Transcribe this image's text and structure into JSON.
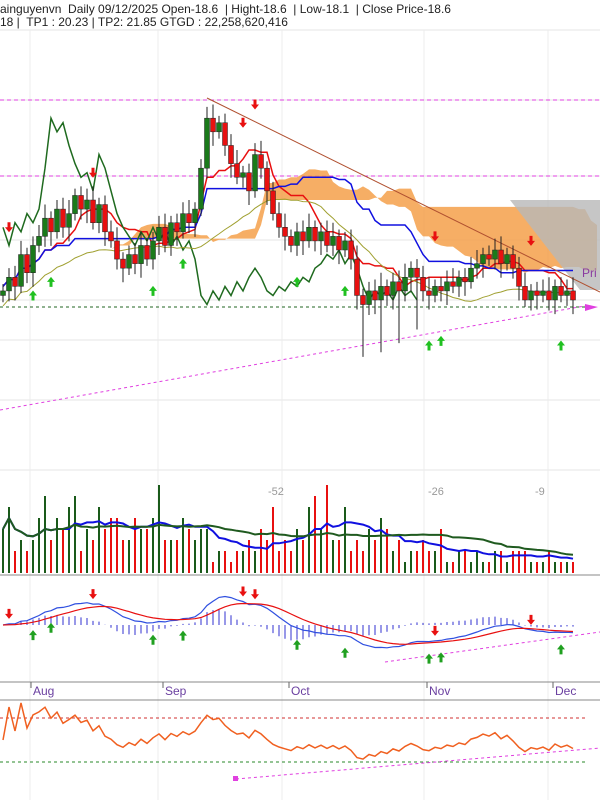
{
  "header": {
    "line1": "ainguyenvn  Daily 09/12/2025 Open-18.6  | Hight-18.6  | Low-18.1  | Close Price-18.6",
    "line2": "18 |  TP1 : 20.23 | TP2: 21.85 GTGD : 22,258,620,416"
  },
  "price_tag": "Pri",
  "volume_labels": [
    "-52",
    "-26",
    "-9"
  ],
  "colors": {
    "up": "#1a7a1a",
    "down": "#e81010",
    "ma_fast": "#e81010",
    "ma_slow": "#1010e0",
    "cloud": "#f5a04a",
    "trend": "#b05030",
    "support": "#e040e0"
  },
  "chart_data": {
    "type": "candlestick",
    "title": "Daily 09/12/2025",
    "months": [
      "Aug",
      "Sep",
      "Oct",
      "Nov",
      "Dec"
    ],
    "month_start_index": [
      4,
      26,
      47,
      70,
      91
    ],
    "close": [
      18.8,
      19.1,
      18.9,
      19.6,
      19.2,
      19.8,
      20.0,
      20.4,
      20.1,
      20.6,
      20.2,
      20.5,
      20.9,
      20.6,
      20.8,
      20.3,
      20.7,
      20.1,
      19.9,
      19.5,
      19.3,
      19.6,
      19.4,
      19.8,
      19.5,
      19.9,
      20.2,
      19.8,
      20.3,
      20.1,
      20.5,
      20.3,
      20.6,
      21.5,
      22.6,
      22.3,
      22.5,
      22.0,
      21.6,
      21.3,
      21.4,
      21.0,
      21.8,
      21.5,
      21.0,
      20.5,
      20.2,
      20.0,
      19.8,
      20.1,
      19.9,
      20.2,
      19.9,
      20.1,
      19.8,
      20.0,
      19.7,
      19.9,
      19.5,
      18.7,
      18.5,
      18.8,
      18.6,
      18.9,
      18.7,
      19.0,
      18.8,
      19.1,
      19.3,
      19.1,
      18.8,
      18.7,
      18.9,
      18.8,
      19.0,
      18.9,
      19.1,
      19.0,
      19.3,
      19.4,
      19.6,
      19.5,
      19.7,
      19.4,
      19.6,
      19.3,
      18.9,
      18.6,
      18.8,
      18.7,
      18.8,
      18.6,
      18.9,
      18.7,
      18.8,
      18.6
    ],
    "volume": [
      4,
      6,
      2,
      3,
      2,
      3,
      5,
      7,
      3,
      5,
      4,
      6,
      7,
      2,
      4,
      3,
      6,
      4,
      5,
      5,
      3,
      3,
      5,
      4,
      4,
      5,
      8,
      3,
      3,
      3,
      5,
      4,
      3,
      4,
      4,
      1,
      2,
      2,
      1,
      2,
      2,
      3,
      2,
      4,
      3,
      6,
      2,
      3,
      2,
      4,
      3,
      6,
      7,
      4,
      8,
      3,
      3,
      6,
      2,
      3,
      2,
      4,
      3,
      5,
      4,
      2,
      3,
      1,
      2,
      2,
      3,
      2,
      2,
      4,
      1,
      1,
      2,
      2,
      1,
      2,
      1,
      1,
      2,
      2,
      1,
      2,
      2,
      2,
      1,
      1,
      1,
      2,
      1,
      1,
      1,
      1
    ],
    "buy_signals": [
      5,
      8,
      25,
      30,
      49,
      57,
      71,
      73,
      93
    ],
    "sell_signals": [
      1,
      15,
      40,
      42,
      72,
      88
    ],
    "rsi_levels": [
      70,
      30
    ]
  }
}
